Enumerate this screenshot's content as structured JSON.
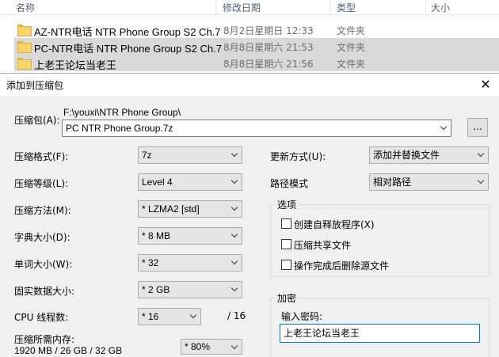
{
  "explorer": {
    "columns": {
      "name": "名称",
      "modified": "修改日期",
      "type": "类型",
      "size": "大小"
    },
    "files": [
      {
        "name": "AZ-NTR电话 NTR Phone Group S2 Ch.7",
        "date": "8月2日星期日 12:33",
        "type": "文件夹"
      },
      {
        "name": "PC-NTR电话 NTR Phone Group S2 Ch.7",
        "date": "8月8日星期六 21:53",
        "type": "文件夹"
      },
      {
        "name": "上老王论坛当老王",
        "date": "8月8日星期六 21:56",
        "type": "文件夹"
      }
    ]
  },
  "dialog": {
    "title": "添加到压缩包",
    "close_glyph": "✕",
    "archive": {
      "label": "压缩包(A):",
      "path": "F:\\youxi\\NTR Phone Group\\",
      "filename": "PC NTR Phone Group.7z",
      "browse_label": "..."
    },
    "left": {
      "format": {
        "label": "压缩格式(F):",
        "value": "7z"
      },
      "level": {
        "label": "压缩等级(L):",
        "value": "Level 4"
      },
      "method": {
        "label": "压缩方法(M):",
        "value": "* LZMA2 [std]"
      },
      "dict": {
        "label": "字典大小(D):",
        "value": "* 8 MB"
      },
      "word": {
        "label": "单词大小(W):",
        "value": "* 32"
      },
      "solid": {
        "label": "固实数据大小:",
        "value": "* 2 GB"
      },
      "threads": {
        "label": "CPU 线程数:",
        "value": "* 16",
        "max": "/ 16"
      },
      "memory": {
        "label": "压缩所需内存:",
        "detail": "1920 MB / 26 GB / 32 GB",
        "value": "* 80%"
      }
    },
    "right": {
      "update": {
        "label": "更新方式(U):",
        "value": "添加并替换文件"
      },
      "pathmode": {
        "label": "路径模式",
        "value": "相对路径"
      },
      "options": {
        "title": "选项",
        "sfx": "创建自释放程序(X)",
        "shared": "压缩共享文件",
        "delete": "操作完成后删除源文件"
      },
      "encryption": {
        "title": "加密",
        "password_label": "输入密码:",
        "password_value": "上老王论坛当老王"
      }
    }
  }
}
